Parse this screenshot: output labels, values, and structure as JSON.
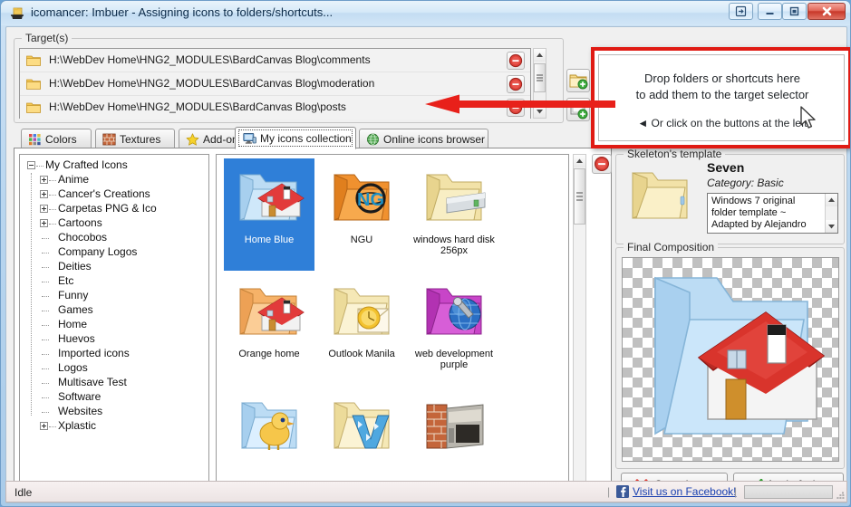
{
  "window": {
    "title": "icomancer: Imbuer - Assigning icons to folders/shortcuts...",
    "app_icon": "anvil-folder-icon",
    "controls": {
      "login": "login-icon",
      "minimize": "minimize-icon",
      "maximize": "maximize-icon",
      "close": "close-icon"
    }
  },
  "targets": {
    "legend": "Target(s)",
    "rows": [
      {
        "path": "H:\\WebDev Home\\HNG2_MODULES\\BardCanvas Blog\\comments",
        "remove_label": "remove-target"
      },
      {
        "path": "H:\\WebDev Home\\HNG2_MODULES\\BardCanvas Blog\\moderation",
        "remove_label": "remove-target"
      },
      {
        "path": "H:\\WebDev Home\\HNG2_MODULES\\BardCanvas Blog\\posts",
        "remove_label": "remove-target"
      }
    ],
    "add_folder_icon": "add-folder-icon",
    "add_shortcut_icon": "add-shortcut-icon"
  },
  "dropzone": {
    "line1": "Drop folders or shortcuts here",
    "line2": "to add them to the target selector",
    "line3": "◄ Or click on the buttons at the left",
    "highlight_color": "#e01b14"
  },
  "annotation": {
    "arrow_color": "#e8201a",
    "name": "red-pointer-arrow"
  },
  "tabs": [
    {
      "label": "Colors",
      "icon": "color-swatches-icon",
      "active": false
    },
    {
      "label": "Textures",
      "icon": "brick-wall-icon",
      "active": false
    },
    {
      "label": "Add-on icons",
      "icon": "star-icon",
      "active": false
    },
    {
      "label": "My icons collection",
      "icon": "monitor-icon",
      "active": true
    },
    {
      "label": "Online icons browser",
      "icon": "globe-icon",
      "active": false
    }
  ],
  "tree": {
    "root": "My Crafted Icons",
    "items": [
      {
        "label": "Anime",
        "expandable": true
      },
      {
        "label": "Cancer's Creations",
        "expandable": true
      },
      {
        "label": "Carpetas PNG & Ico",
        "expandable": true
      },
      {
        "label": "Cartoons",
        "expandable": true
      },
      {
        "label": "Chocobos",
        "expandable": false
      },
      {
        "label": "Company Logos",
        "expandable": false
      },
      {
        "label": "Deities",
        "expandable": false
      },
      {
        "label": "Etc",
        "expandable": false
      },
      {
        "label": "Funny",
        "expandable": false
      },
      {
        "label": "Games",
        "expandable": false
      },
      {
        "label": "Home",
        "expandable": false
      },
      {
        "label": "Huevos",
        "expandable": false
      },
      {
        "label": "Imported icons",
        "expandable": false
      },
      {
        "label": "Logos",
        "expandable": false
      },
      {
        "label": "Multisave Test",
        "expandable": false
      },
      {
        "label": "Software",
        "expandable": false
      },
      {
        "label": "Websites",
        "expandable": false
      },
      {
        "label": "Xplastic",
        "expandable": true
      }
    ]
  },
  "icon_grid": {
    "remove_button": "remove-icon-button",
    "items": [
      {
        "label": "Home Blue",
        "kind": "folder-house-blue",
        "selected": true
      },
      {
        "label": "NGU",
        "kind": "folder-ngu-orange",
        "selected": false
      },
      {
        "label": "windows hard disk 256px",
        "kind": "folder-harddisk-cream",
        "selected": false
      },
      {
        "label": "Orange home",
        "kind": "folder-house-orange",
        "selected": false
      },
      {
        "label": "Outlook Manila",
        "kind": "folder-outlook-cream",
        "selected": false
      },
      {
        "label": "web development purple",
        "kind": "folder-globe-wrench-purple",
        "selected": false
      },
      {
        "label": "",
        "kind": "folder-chocobo-blue",
        "selected": false
      },
      {
        "label": "",
        "kind": "folder-v-cream",
        "selected": false
      },
      {
        "label": "",
        "kind": "folder-brickwall",
        "selected": false
      }
    ]
  },
  "skeleton": {
    "legend": "Skeleton's template",
    "name": "Seven",
    "category": "Category: Basic",
    "description": "Windows 7 original folder template\n~ Adapted by Alejandro",
    "thumb": "cream-folder-icon"
  },
  "final": {
    "legend": "Final Composition",
    "art": "blue-folder-with-red-roof-house"
  },
  "actions": {
    "cancel": {
      "pre": "",
      "accel": "C",
      "post": "ancel",
      "icon": "red-x-icon"
    },
    "apply": {
      "pre": "",
      "accel": "A",
      "post": "pply & close",
      "icon": "green-check-icon"
    }
  },
  "status": {
    "text": "Idle",
    "separator": "|",
    "facebook_link": "Visit us on Facebook!",
    "facebook_icon": "facebook-icon"
  }
}
